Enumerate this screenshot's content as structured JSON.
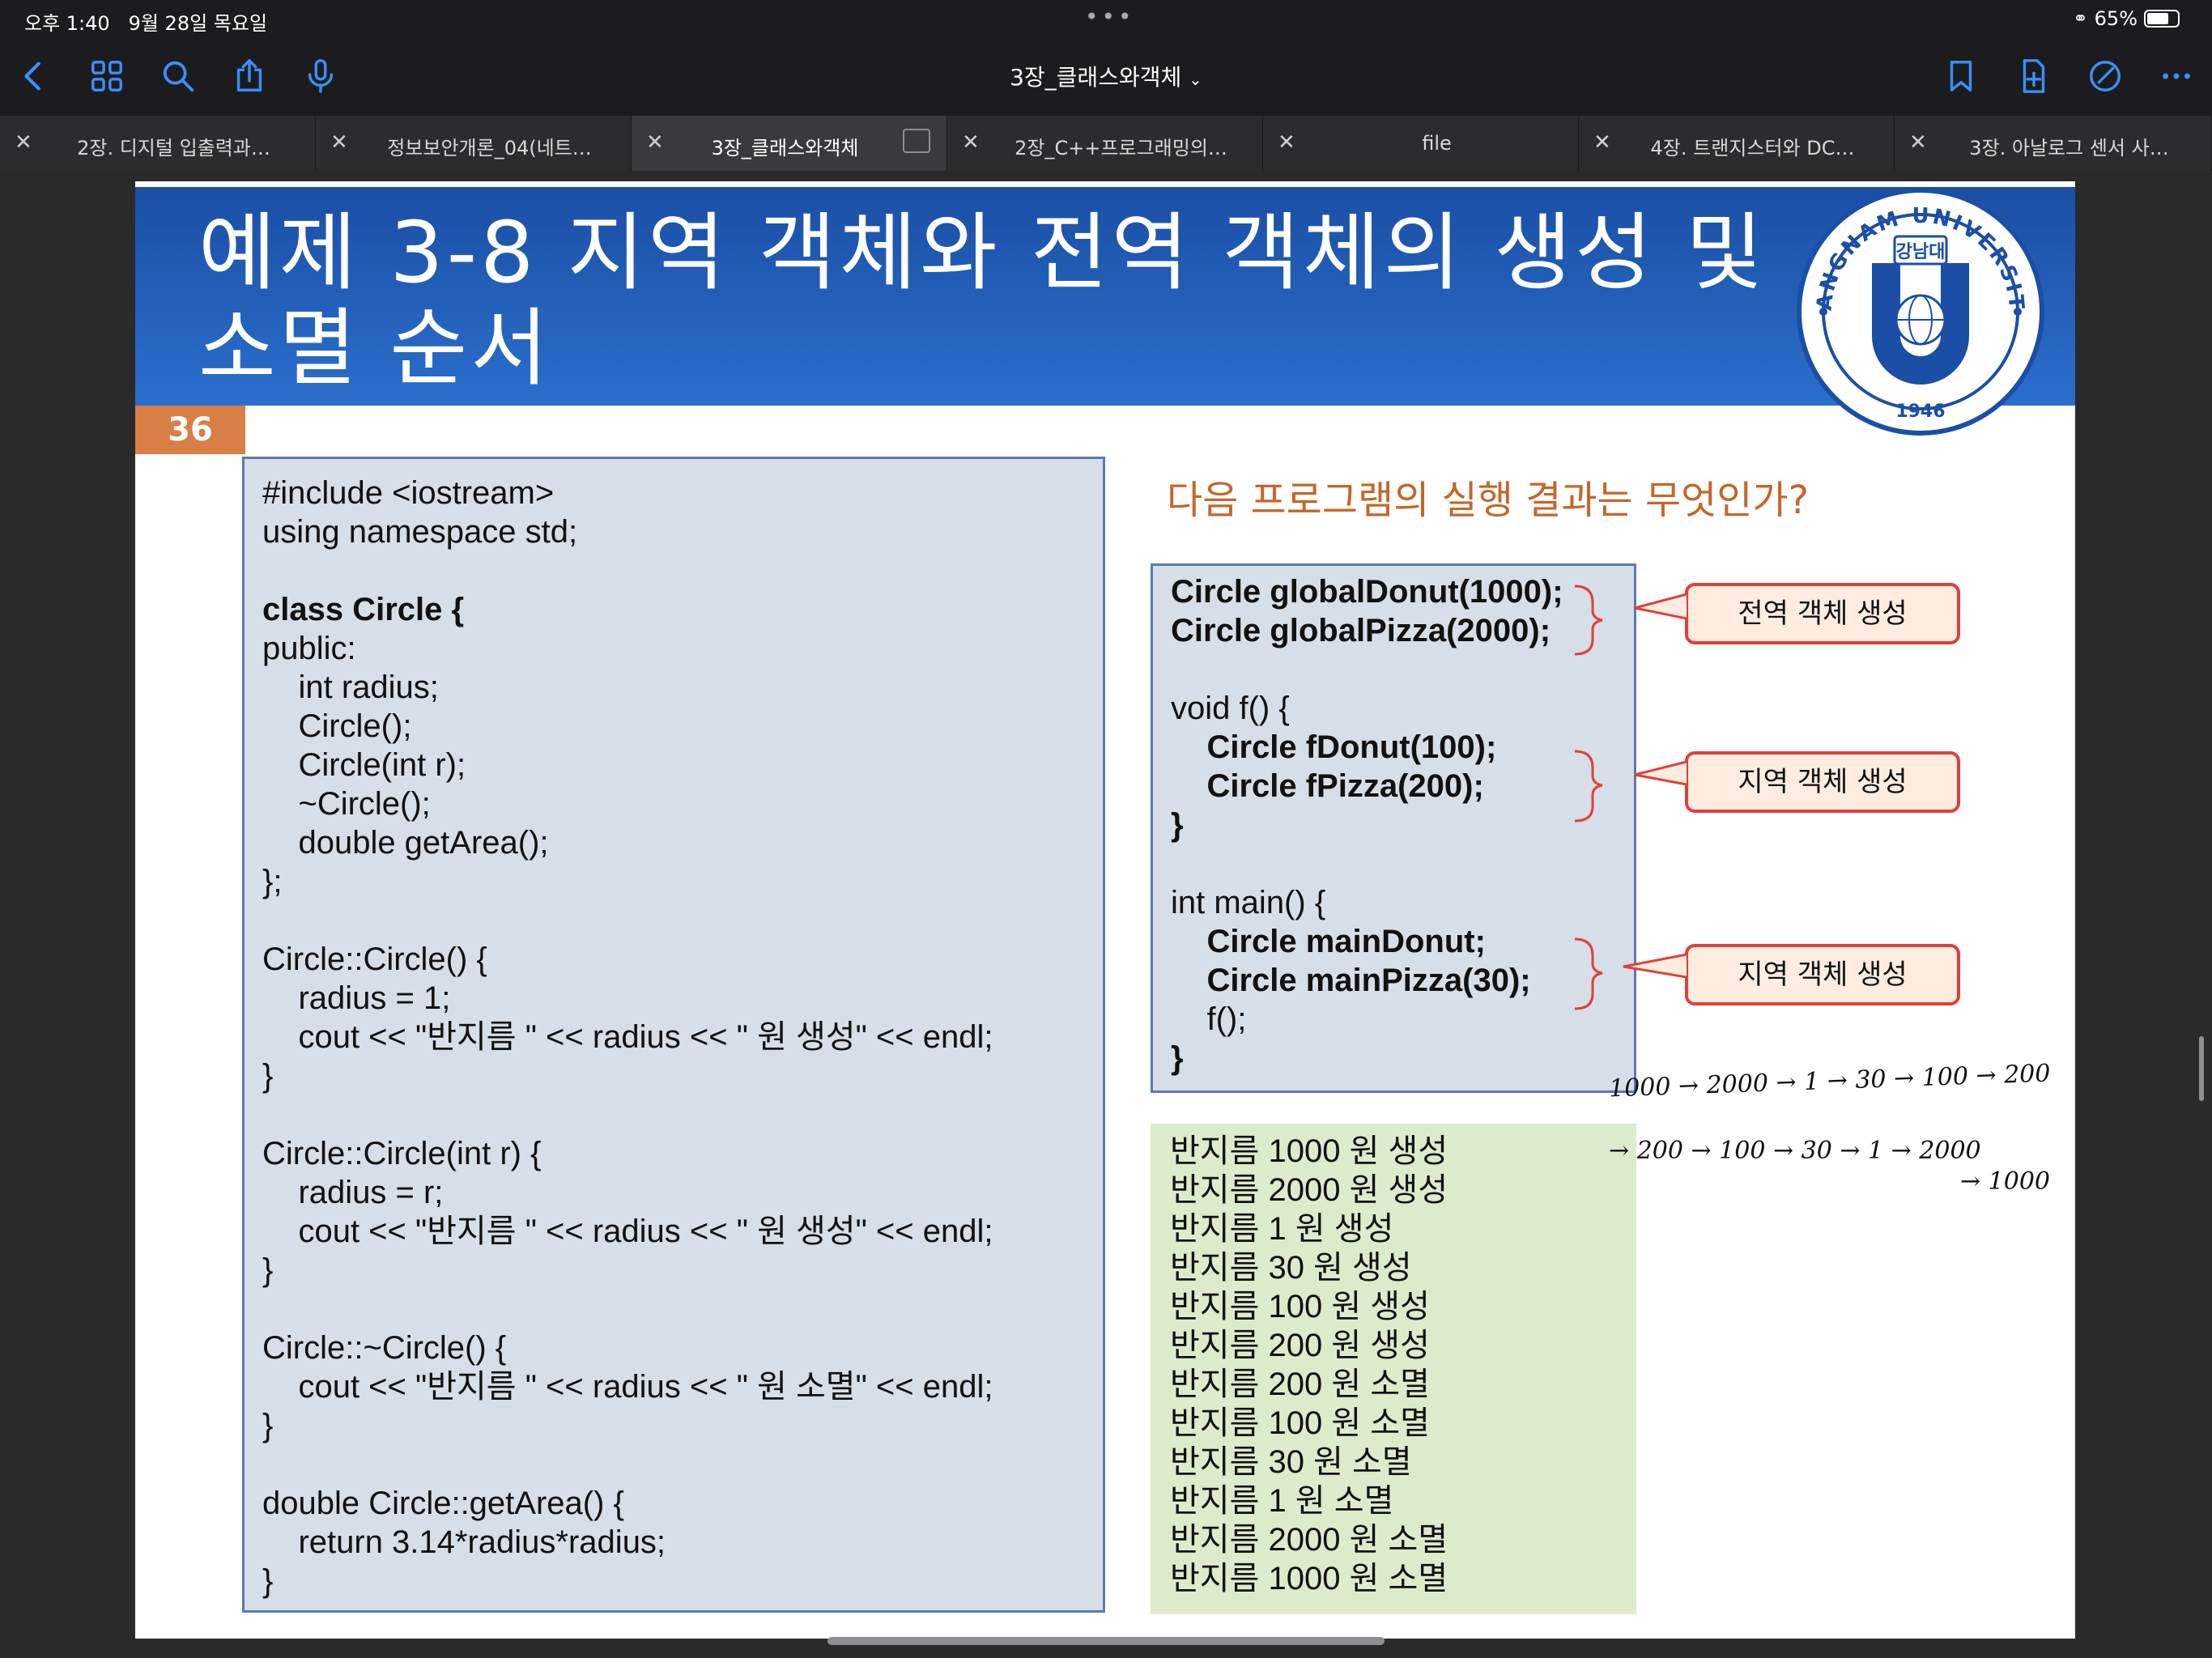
{
  "status_bar": {
    "time": "오후 1:40",
    "date": "9월 28일 목요일",
    "battery": "65%"
  },
  "toolbar": {
    "title": "3장_클래스와객체"
  },
  "tabs": [
    {
      "label": "2장. 디지털 입출력과…"
    },
    {
      "label": "정보보안개론_04(네트…"
    },
    {
      "label": "3장_클래스와객체"
    },
    {
      "label": "2장_C++프로그래밍의…"
    },
    {
      "label": "file"
    },
    {
      "label": "4장. 트랜지스터와 DC…"
    },
    {
      "label": "3장. 아날로그 센서 사…"
    }
  ],
  "slide": {
    "title_line1": "예제 3-8 지역 객체와 전역 객체의 생성 및",
    "title_line2": "소멸 순서",
    "page_number": "36",
    "logo": {
      "top_text": "KANGNAM UNIVERSITY",
      "badge": "강남대",
      "year": "1946"
    },
    "question": "다음 프로그램의 실행 결과는 무엇인가?",
    "code_lines": [
      {
        "text": "#include <iostream>",
        "bold": false
      },
      {
        "text": "using namespace std;",
        "bold": false
      },
      {
        "text": "",
        "bold": false
      },
      {
        "text": "class Circle {",
        "bold": true
      },
      {
        "text": "public:",
        "bold": false
      },
      {
        "text": "    int radius;",
        "bold": false
      },
      {
        "text": "    Circle();",
        "bold": false
      },
      {
        "text": "    Circle(int r);",
        "bold": false
      },
      {
        "text": "    ~Circle();",
        "bold": false
      },
      {
        "text": "    double getArea();",
        "bold": false
      },
      {
        "text": "};",
        "bold": false
      },
      {
        "text": "",
        "bold": false
      },
      {
        "text": "Circle::Circle() {",
        "bold": false
      },
      {
        "text": "    radius = 1;",
        "bold": false
      },
      {
        "text": "    cout << \"반지름 \" << radius << \" 원 생성\" << endl;",
        "bold": false
      },
      {
        "text": "}",
        "bold": false
      },
      {
        "text": "",
        "bold": false
      },
      {
        "text": "Circle::Circle(int r) {",
        "bold": false
      },
      {
        "text": "    radius = r;",
        "bold": false
      },
      {
        "text": "    cout << \"반지름 \" << radius << \" 원 생성\" << endl;",
        "bold": false
      },
      {
        "text": "}",
        "bold": false
      },
      {
        "text": "",
        "bold": false
      },
      {
        "text": "Circle::~Circle() {",
        "bold": false
      },
      {
        "text": "    cout << \"반지름 \" << radius << \" 원 소멸\" << endl;",
        "bold": false
      },
      {
        "text": "}",
        "bold": false
      },
      {
        "text": "",
        "bold": false
      },
      {
        "text": "double Circle::getArea() {",
        "bold": false
      },
      {
        "text": "    return 3.14*radius*radius;",
        "bold": false
      },
      {
        "text": "}",
        "bold": false
      }
    ],
    "program_lines": [
      {
        "text": "Circle globalDonut(1000);",
        "bold": true
      },
      {
        "text": "Circle globalPizza(2000);",
        "bold": true
      },
      {
        "text": "",
        "bold": false
      },
      {
        "text": "void f() {",
        "bold": false
      },
      {
        "text": "    Circle fDonut(100);",
        "bold": true
      },
      {
        "text": "    Circle fPizza(200);",
        "bold": true
      },
      {
        "text": "}",
        "bold": true
      },
      {
        "text": "",
        "bold": false
      },
      {
        "text": "int main() {",
        "bold": false
      },
      {
        "text": "    Circle mainDonut;",
        "bold": true
      },
      {
        "text": "    Circle mainPizza(30);",
        "bold": true
      },
      {
        "text": "    f();",
        "bold": false
      },
      {
        "text": "}",
        "bold": true
      }
    ],
    "callouts": {
      "global": "전역 객체 생성",
      "local_f": "지역 객체 생성",
      "local_main": "지역 객체 생성"
    },
    "output_lines": [
      "반지름 1000 원 생성",
      "반지름 2000 원 생성",
      "반지름 1 원 생성",
      "반지름 30 원 생성",
      "반지름 100 원 생성",
      "반지름 200 원 생성",
      "반지름 200 원 소멸",
      "반지름 100 원 소멸",
      "반지름 30 원 소멸",
      "반지름 1 원 소멸",
      "반지름 2000 원 소멸",
      "반지름 1000 원 소멸"
    ],
    "handwriting": {
      "line1": "1000 → 2000 → 1 → 30 → 100 → 200",
      "line2": "→ 200 → 100 → 30 → 1 → 2000",
      "line3": "→ 1000"
    }
  },
  "colors": {
    "header_blue": "#1b4fa5",
    "accent_ios": "#3a8ff7",
    "page_num": "#d97f45",
    "question": "#c5662a",
    "callout_border": "#e0403a"
  }
}
